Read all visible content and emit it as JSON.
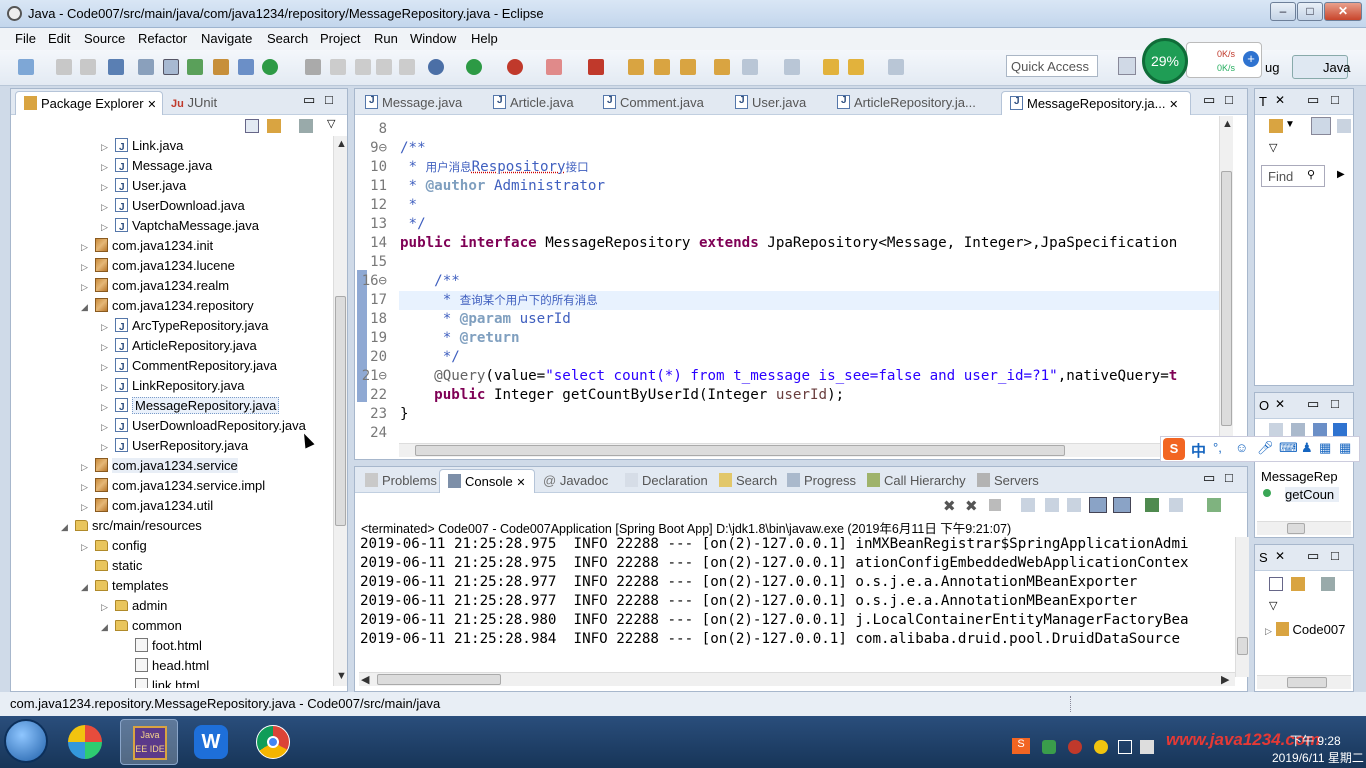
{
  "window": {
    "title": "Java - Code007/src/main/java/com/java1234/repository/MessageRepository.java - Eclipse",
    "min": "‒",
    "max": "□",
    "close": "✕"
  },
  "menu": [
    "File",
    "Edit",
    "Source",
    "Refactor",
    "Navigate",
    "Search",
    "Project",
    "Run",
    "Window",
    "Help"
  ],
  "toolbar": {
    "quick_access": "Quick Access",
    "perspective": "Java",
    "debug_partial": "ug"
  },
  "netmon": {
    "percent": "29%",
    "up": "0K/s",
    "down": "0K/s"
  },
  "explorer": {
    "tabs": [
      "Package Explorer",
      "JUnit"
    ],
    "rows": [
      {
        "label": "Link.java",
        "icon": "java-file-icon",
        "twisty": "▷"
      },
      {
        "label": "Message.java",
        "icon": "java-file-icon",
        "twisty": "▷"
      },
      {
        "label": "User.java",
        "icon": "java-file-icon",
        "twisty": "▷"
      },
      {
        "label": "UserDownload.java",
        "icon": "java-file-icon",
        "twisty": "▷"
      },
      {
        "label": "VaptchaMessage.java",
        "icon": "java-file-icon",
        "twisty": "▷"
      },
      {
        "label": "com.java1234.init",
        "icon": "package-icon",
        "twisty": "▷"
      },
      {
        "label": "com.java1234.lucene",
        "icon": "package-icon",
        "twisty": "▷"
      },
      {
        "label": "com.java1234.realm",
        "icon": "package-icon",
        "twisty": "▷"
      },
      {
        "label": "com.java1234.repository",
        "icon": "package-icon",
        "twisty": "◢"
      },
      {
        "label": "ArcTypeRepository.java",
        "icon": "java-file-icon",
        "twisty": "▷"
      },
      {
        "label": "ArticleRepository.java",
        "icon": "java-file-icon",
        "twisty": "▷"
      },
      {
        "label": "CommentRepository.java",
        "icon": "java-file-icon",
        "twisty": "▷"
      },
      {
        "label": "LinkRepository.java",
        "icon": "java-file-icon",
        "twisty": "▷"
      },
      {
        "label": "MessageRepository.java",
        "icon": "java-file-icon",
        "twisty": "▷"
      },
      {
        "label": "UserDownloadRepository.java",
        "icon": "java-file-icon",
        "twisty": "▷"
      },
      {
        "label": "UserRepository.java",
        "icon": "java-file-icon",
        "twisty": "▷"
      },
      {
        "label": "com.java1234.service",
        "icon": "package-icon",
        "twisty": "▷"
      },
      {
        "label": "com.java1234.service.impl",
        "icon": "package-icon",
        "twisty": "▷"
      },
      {
        "label": "com.java1234.util",
        "icon": "package-icon",
        "twisty": "▷"
      },
      {
        "label": "src/main/resources",
        "icon": "source-folder-icon",
        "twisty": "◢"
      },
      {
        "label": "config",
        "icon": "folder-icon",
        "twisty": "▷"
      },
      {
        "label": "static",
        "icon": "folder-icon",
        "twisty": ""
      },
      {
        "label": "templates",
        "icon": "folder-icon",
        "twisty": "◢"
      },
      {
        "label": "admin",
        "icon": "folder-icon",
        "twisty": "▷"
      },
      {
        "label": "common",
        "icon": "folder-icon",
        "twisty": "◢"
      },
      {
        "label": "foot.html",
        "icon": "html-file-icon",
        "twisty": ""
      },
      {
        "label": "head.html",
        "icon": "html-file-icon",
        "twisty": ""
      },
      {
        "label": "link.html",
        "icon": "html-file-icon",
        "twisty": ""
      }
    ]
  },
  "editor": {
    "tabs": [
      "Message.java",
      "Article.java",
      "Comment.java",
      "User.java",
      "ArticleRepository.ja...",
      "MessageRepository.ja..."
    ],
    "line_numbers": [
      "8",
      "9⊖",
      "10",
      "11",
      "12",
      "13",
      "14",
      "15",
      "16⊖",
      "17",
      "18",
      "19",
      "20",
      "21⊖",
      "22",
      "23",
      "24"
    ],
    "lines": {
      "l9": "/**",
      "l10a": " * ",
      "l10b": "用户消息",
      "l10c": "Respository",
      "l10d": "接口",
      "l11a": " * ",
      "l11b": "@author",
      "l11c": " Administrator",
      "l12": " *",
      "l13": " */",
      "l14a": "public interface",
      "l14b": " MessageRepository ",
      "l14c": "extends",
      "l14d": " JpaRepository<Message, Integer>,JpaSpecification",
      "l16": "    /**",
      "l17a": "     * ",
      "l17b": "查询某个用户下的所有消息",
      "l18a": "     * ",
      "l18b": "@param",
      "l18c": " userId",
      "l19a": "     * ",
      "l19b": "@return",
      "l20": "     */",
      "l21a": "    @Query",
      "l21b": "(value=",
      "l21c": "\"select count(*) from t_message is_see=false and user_id=?1\"",
      "l21d": ",nativeQuery=",
      "l21e": "t",
      "l22a": "    ",
      "l22b": "public",
      "l22c": " Integer getCountByUserId(Integer ",
      "l22d": "userId",
      "l22e": ");",
      "l23": "}"
    }
  },
  "bottom": {
    "tabs": [
      "Problems",
      "Console",
      "Javadoc",
      "Declaration",
      "Search",
      "Progress",
      "Call Hierarchy",
      "Servers"
    ],
    "terminated": "<terminated> Code007 - Code007Application [Spring Boot App] D:\\jdk1.8\\bin\\javaw.exe (2019年6月11日 下午9:21:07)",
    "log": [
      "2019-06-11 21:25:28.975  INFO 22288 --- [on(2)-127.0.0.1] inMXBeanRegistrar$SpringApplicationAdmi",
      "2019-06-11 21:25:28.975  INFO 22288 --- [on(2)-127.0.0.1] ationConfigEmbeddedWebApplicationContex",
      "2019-06-11 21:25:28.977  INFO 22288 --- [on(2)-127.0.0.1] o.s.j.e.a.AnnotationMBeanExporter",
      "2019-06-11 21:25:28.977  INFO 22288 --- [on(2)-127.0.0.1] o.s.j.e.a.AnnotationMBeanExporter",
      "2019-06-11 21:25:28.980  INFO 22288 --- [on(2)-127.0.0.1] j.LocalContainerEntityManagerFactoryBea",
      "2019-06-11 21:25:28.984  INFO 22288 --- [on(2)-127.0.0.1] com.alibaba.druid.pool.DruidDataSource"
    ]
  },
  "right": {
    "t_tab": "T",
    "find": "Find",
    "o_tab": "O",
    "s_tab": "S",
    "outline_title": "MessageRep",
    "outline_item": "getCoun",
    "project_item": "Code007"
  },
  "status": {
    "path": "com.java1234.repository.MessageRepository.java - Code007/src/main/java"
  },
  "taskbar": {
    "time": "下午 9:28",
    "date": "2019/6/11 星期二",
    "watermark": "www.java1234.com"
  }
}
